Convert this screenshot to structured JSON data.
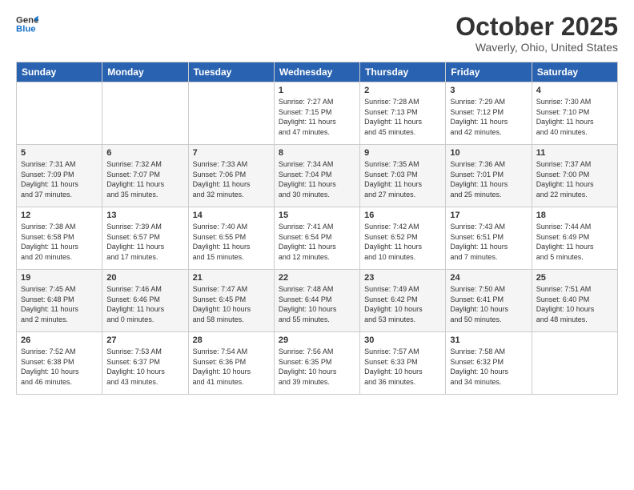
{
  "header": {
    "logo_line1": "General",
    "logo_line2": "Blue",
    "month_title": "October 2025",
    "location": "Waverly, Ohio, United States"
  },
  "days_of_week": [
    "Sunday",
    "Monday",
    "Tuesday",
    "Wednesday",
    "Thursday",
    "Friday",
    "Saturday"
  ],
  "weeks": [
    [
      {
        "day": "",
        "content": ""
      },
      {
        "day": "",
        "content": ""
      },
      {
        "day": "",
        "content": ""
      },
      {
        "day": "1",
        "content": "Sunrise: 7:27 AM\nSunset: 7:15 PM\nDaylight: 11 hours\nand 47 minutes."
      },
      {
        "day": "2",
        "content": "Sunrise: 7:28 AM\nSunset: 7:13 PM\nDaylight: 11 hours\nand 45 minutes."
      },
      {
        "day": "3",
        "content": "Sunrise: 7:29 AM\nSunset: 7:12 PM\nDaylight: 11 hours\nand 42 minutes."
      },
      {
        "day": "4",
        "content": "Sunrise: 7:30 AM\nSunset: 7:10 PM\nDaylight: 11 hours\nand 40 minutes."
      }
    ],
    [
      {
        "day": "5",
        "content": "Sunrise: 7:31 AM\nSunset: 7:09 PM\nDaylight: 11 hours\nand 37 minutes."
      },
      {
        "day": "6",
        "content": "Sunrise: 7:32 AM\nSunset: 7:07 PM\nDaylight: 11 hours\nand 35 minutes."
      },
      {
        "day": "7",
        "content": "Sunrise: 7:33 AM\nSunset: 7:06 PM\nDaylight: 11 hours\nand 32 minutes."
      },
      {
        "day": "8",
        "content": "Sunrise: 7:34 AM\nSunset: 7:04 PM\nDaylight: 11 hours\nand 30 minutes."
      },
      {
        "day": "9",
        "content": "Sunrise: 7:35 AM\nSunset: 7:03 PM\nDaylight: 11 hours\nand 27 minutes."
      },
      {
        "day": "10",
        "content": "Sunrise: 7:36 AM\nSunset: 7:01 PM\nDaylight: 11 hours\nand 25 minutes."
      },
      {
        "day": "11",
        "content": "Sunrise: 7:37 AM\nSunset: 7:00 PM\nDaylight: 11 hours\nand 22 minutes."
      }
    ],
    [
      {
        "day": "12",
        "content": "Sunrise: 7:38 AM\nSunset: 6:58 PM\nDaylight: 11 hours\nand 20 minutes."
      },
      {
        "day": "13",
        "content": "Sunrise: 7:39 AM\nSunset: 6:57 PM\nDaylight: 11 hours\nand 17 minutes."
      },
      {
        "day": "14",
        "content": "Sunrise: 7:40 AM\nSunset: 6:55 PM\nDaylight: 11 hours\nand 15 minutes."
      },
      {
        "day": "15",
        "content": "Sunrise: 7:41 AM\nSunset: 6:54 PM\nDaylight: 11 hours\nand 12 minutes."
      },
      {
        "day": "16",
        "content": "Sunrise: 7:42 AM\nSunset: 6:52 PM\nDaylight: 11 hours\nand 10 minutes."
      },
      {
        "day": "17",
        "content": "Sunrise: 7:43 AM\nSunset: 6:51 PM\nDaylight: 11 hours\nand 7 minutes."
      },
      {
        "day": "18",
        "content": "Sunrise: 7:44 AM\nSunset: 6:49 PM\nDaylight: 11 hours\nand 5 minutes."
      }
    ],
    [
      {
        "day": "19",
        "content": "Sunrise: 7:45 AM\nSunset: 6:48 PM\nDaylight: 11 hours\nand 2 minutes."
      },
      {
        "day": "20",
        "content": "Sunrise: 7:46 AM\nSunset: 6:46 PM\nDaylight: 11 hours\nand 0 minutes."
      },
      {
        "day": "21",
        "content": "Sunrise: 7:47 AM\nSunset: 6:45 PM\nDaylight: 10 hours\nand 58 minutes."
      },
      {
        "day": "22",
        "content": "Sunrise: 7:48 AM\nSunset: 6:44 PM\nDaylight: 10 hours\nand 55 minutes."
      },
      {
        "day": "23",
        "content": "Sunrise: 7:49 AM\nSunset: 6:42 PM\nDaylight: 10 hours\nand 53 minutes."
      },
      {
        "day": "24",
        "content": "Sunrise: 7:50 AM\nSunset: 6:41 PM\nDaylight: 10 hours\nand 50 minutes."
      },
      {
        "day": "25",
        "content": "Sunrise: 7:51 AM\nSunset: 6:40 PM\nDaylight: 10 hours\nand 48 minutes."
      }
    ],
    [
      {
        "day": "26",
        "content": "Sunrise: 7:52 AM\nSunset: 6:38 PM\nDaylight: 10 hours\nand 46 minutes."
      },
      {
        "day": "27",
        "content": "Sunrise: 7:53 AM\nSunset: 6:37 PM\nDaylight: 10 hours\nand 43 minutes."
      },
      {
        "day": "28",
        "content": "Sunrise: 7:54 AM\nSunset: 6:36 PM\nDaylight: 10 hours\nand 41 minutes."
      },
      {
        "day": "29",
        "content": "Sunrise: 7:56 AM\nSunset: 6:35 PM\nDaylight: 10 hours\nand 39 minutes."
      },
      {
        "day": "30",
        "content": "Sunrise: 7:57 AM\nSunset: 6:33 PM\nDaylight: 10 hours\nand 36 minutes."
      },
      {
        "day": "31",
        "content": "Sunrise: 7:58 AM\nSunset: 6:32 PM\nDaylight: 10 hours\nand 34 minutes."
      },
      {
        "day": "",
        "content": ""
      }
    ]
  ]
}
